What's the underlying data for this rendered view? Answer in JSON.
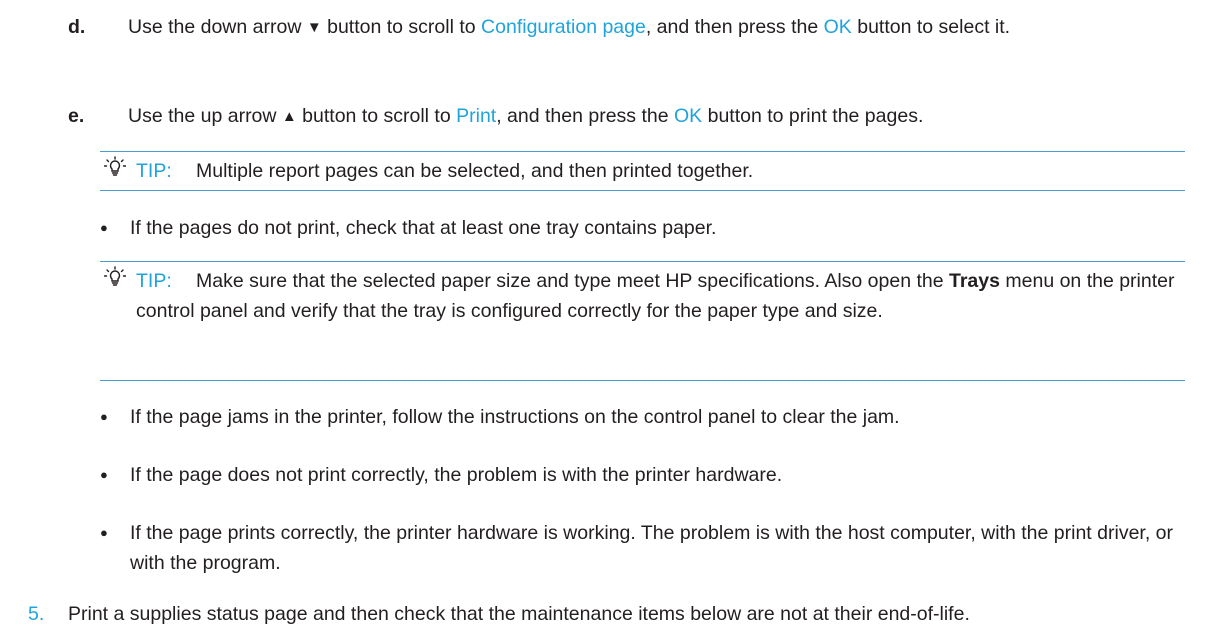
{
  "step_d": {
    "label": "d.",
    "t1": "Use the down arrow ",
    "arrow": "▼",
    "t2": " button to scroll to ",
    "link1": "Configuration page",
    "t3": ", and then press the ",
    "link2": "OK",
    "t4": " button to select it."
  },
  "step_e": {
    "label": "e.",
    "t1": "Use the up arrow ",
    "arrow": "▲",
    "t2": " button to scroll to ",
    "link1": "Print",
    "t3": ", and then press the ",
    "link2": "OK",
    "t4": " button to print the pages."
  },
  "tip1": {
    "label": "TIP:",
    "text": "Multiple report pages can be selected, and then printed together."
  },
  "bullet_symbol": "●",
  "bullet1": "If the pages do not print, check that at least one tray contains paper.",
  "tip2": {
    "label": "TIP:",
    "t1": "Make sure that the selected paper size and type meet HP specifications. Also open the ",
    "bold": "Trays",
    "t2": " menu on the printer control panel and verify that the tray is configured correctly for the paper type and size."
  },
  "bullet2": "If the page jams in the printer, follow the instructions on the control panel to clear the jam.",
  "bullet3": "If the page does not print correctly, the problem is with the printer hardware.",
  "bullet4": "If the page prints correctly, the printer hardware is working. The problem is with the host computer, with the print driver, or with the program.",
  "step5": {
    "label": "5.",
    "text": "Print a supplies status page and then check that the maintenance items below are not at their end-of-life."
  },
  "colors": {
    "accent": "#1fa3dc",
    "rule": "#4a9fd0",
    "text": "#231f20"
  },
  "icons": {
    "tip": "lightbulb-icon"
  }
}
